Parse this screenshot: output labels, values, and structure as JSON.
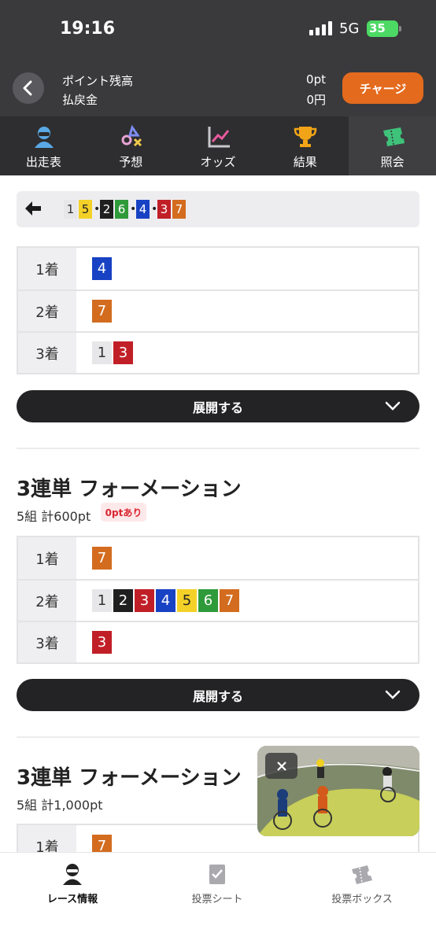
{
  "status": {
    "time": "19:16",
    "network": "5G",
    "battery": "35"
  },
  "header": {
    "points_label": "ポイント残高",
    "refund_label": "払戻金",
    "points_value": "0pt",
    "refund_value": "0円",
    "charge_label": "チャージ"
  },
  "tabs": [
    {
      "label": "出走表",
      "icon": "racer-icon"
    },
    {
      "label": "予想",
      "icon": "prediction-icon"
    },
    {
      "label": "オッズ",
      "icon": "odds-chart-icon"
    },
    {
      "label": "結果",
      "icon": "trophy-icon"
    },
    {
      "label": "照会",
      "icon": "ticket-icon",
      "active": true
    }
  ],
  "result_strip": {
    "first": "1",
    "groups": [
      "5",
      "2",
      "6",
      "4",
      "3",
      "7"
    ]
  },
  "bet1": {
    "rows": [
      {
        "label": "1着",
        "nums": [
          "4"
        ]
      },
      {
        "label": "2着",
        "nums": [
          "7"
        ]
      },
      {
        "label": "3着",
        "nums": [
          "1",
          "3"
        ]
      }
    ],
    "expand_label": "展開する"
  },
  "bet2": {
    "title": "3連単 フォーメーション",
    "summary": "5組 計600pt",
    "badge": "0ptあり",
    "rows": [
      {
        "label": "1着",
        "nums": [
          "7"
        ]
      },
      {
        "label": "2着",
        "nums": [
          "1",
          "2",
          "3",
          "4",
          "5",
          "6",
          "7"
        ]
      },
      {
        "label": "3着",
        "nums": [
          "3"
        ]
      }
    ],
    "expand_label": "展開する"
  },
  "bet3": {
    "title": "3連単 フォーメーション",
    "summary": "5組 計1,000pt",
    "rows": [
      {
        "label": "1着",
        "nums": [
          "7"
        ]
      }
    ]
  },
  "colors": {
    "accent": "#e46a1e",
    "header_bg": "#3a3a3c",
    "num_1": "#e7e7ea",
    "num_2": "#1f1f1f",
    "num_3": "#c11f27",
    "num_4": "#1842c4",
    "num_5": "#f4d128",
    "num_6": "#2f9a3a",
    "num_7": "#d36c1e"
  },
  "bottom_nav": [
    {
      "label": "レース情報",
      "icon": "race-info-icon",
      "active": true
    },
    {
      "label": "投票シート",
      "icon": "vote-sheet-icon"
    },
    {
      "label": "投票ボックス",
      "icon": "vote-box-icon"
    }
  ]
}
